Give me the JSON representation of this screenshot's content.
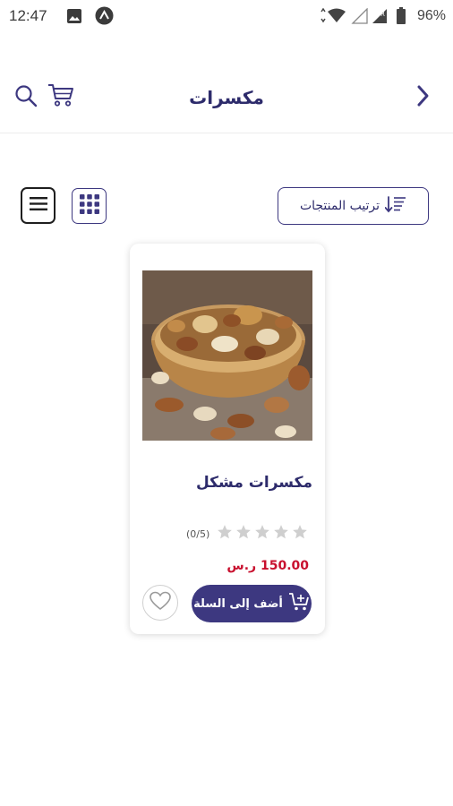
{
  "status_bar": {
    "time": "12:47",
    "battery": "96%"
  },
  "header": {
    "title": "مكسرات"
  },
  "toolbar": {
    "sort_label": "ترتيب المنتجات"
  },
  "products": [
    {
      "name": "مكسرات مشكل",
      "rating_text": "(0/5)",
      "rating_value": 0,
      "rating_max": 5,
      "price": "150.00 ر.س",
      "add_to_cart_label": "أضف إلى السلة"
    }
  ],
  "colors": {
    "brand": "#3d3880",
    "title": "#2d2b6b",
    "price": "#c8102e",
    "star_empty": "#cfcfcf"
  },
  "icons": [
    "image-icon",
    "notification-icon",
    "wifi-icon",
    "signal-icon",
    "battery-icon",
    "search-icon",
    "cart-icon",
    "back-arrow-icon",
    "list-view-icon",
    "grid-view-icon",
    "sort-icon",
    "star-icon",
    "add-cart-icon",
    "heart-icon"
  ]
}
